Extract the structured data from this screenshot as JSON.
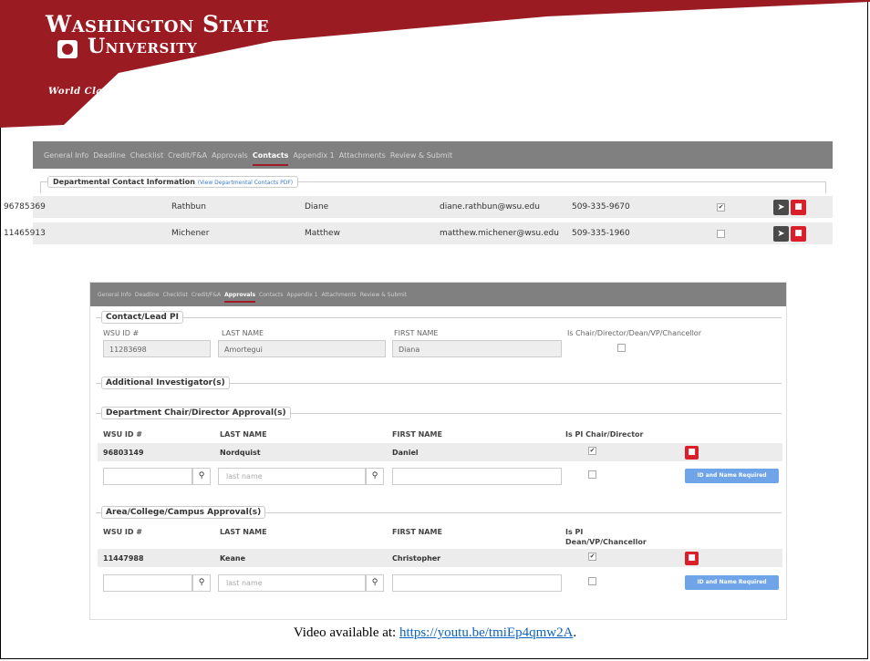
{
  "colors": {
    "crimson": "#9b1b22",
    "nav_grey": "#808080",
    "delete_red": "#d81f2a",
    "link_blue": "#0b63c4",
    "button_blue": "#6fa4e8"
  },
  "logo": {
    "line1": "Washington State",
    "line2": "University",
    "tagline": "World Class. Face to Face."
  },
  "nav_tabs": [
    "General Info",
    "Deadline",
    "Checklist",
    "Credit/F&A",
    "Approvals",
    "Contacts",
    "Appendix 1",
    "Attachments",
    "Review & Submit"
  ],
  "top_screen": {
    "active_tab": "Contacts",
    "section_title": "Departmental Contact Information",
    "section_link": "(View Departmental Contacts PDF)",
    "contacts": [
      {
        "id": "96785369",
        "last": "Rathbun",
        "first": "Diane",
        "email": "diane.rathbun@wsu.edu",
        "phone": "509-335-9670",
        "checked": true
      },
      {
        "id": "11465913",
        "last": "Michener",
        "first": "Matthew",
        "email": "matthew.michener@wsu.edu",
        "phone": "509-335-1960",
        "checked": false
      }
    ]
  },
  "approvals_screen": {
    "active_tab": "Approvals",
    "lead_pi": {
      "legend": "Contact/Lead PI",
      "labels": {
        "id": "WSU ID #",
        "last": "LAST NAME",
        "first": "FIRST NAME",
        "chair": "Is Chair/Director/Dean/VP/Chancellor"
      },
      "id": "11283698",
      "last": "Amortegui",
      "first": "Diana"
    },
    "additional_legend": "Additional Investigator(s)",
    "dept": {
      "legend": "Department Chair/Director Approval(s)",
      "headers": {
        "id": "WSU ID #",
        "last": "LAST NAME",
        "first": "FIRST NAME",
        "flag": "Is PI Chair/Director"
      },
      "row": {
        "id": "96803149",
        "last": "Nordquist",
        "first": "Daniel"
      },
      "placeholder": "last name",
      "button": "ID and Name Required"
    },
    "area": {
      "legend": "Area/College/Campus Approval(s)",
      "headers": {
        "id": "WSU ID #",
        "last": "LAST NAME",
        "first": "FIRST NAME",
        "flag_l1": "Is PI",
        "flag_l2": "Dean/VP/Chancellor"
      },
      "row": {
        "id": "11447988",
        "last": "Keane",
        "first": "Christopher"
      },
      "placeholder": "last name",
      "button": "ID and Name Required"
    }
  },
  "footer": {
    "prefix": "Video available at: ",
    "link": "https://youtu.be/tmiEp4qmw2A",
    "suffix": "."
  }
}
